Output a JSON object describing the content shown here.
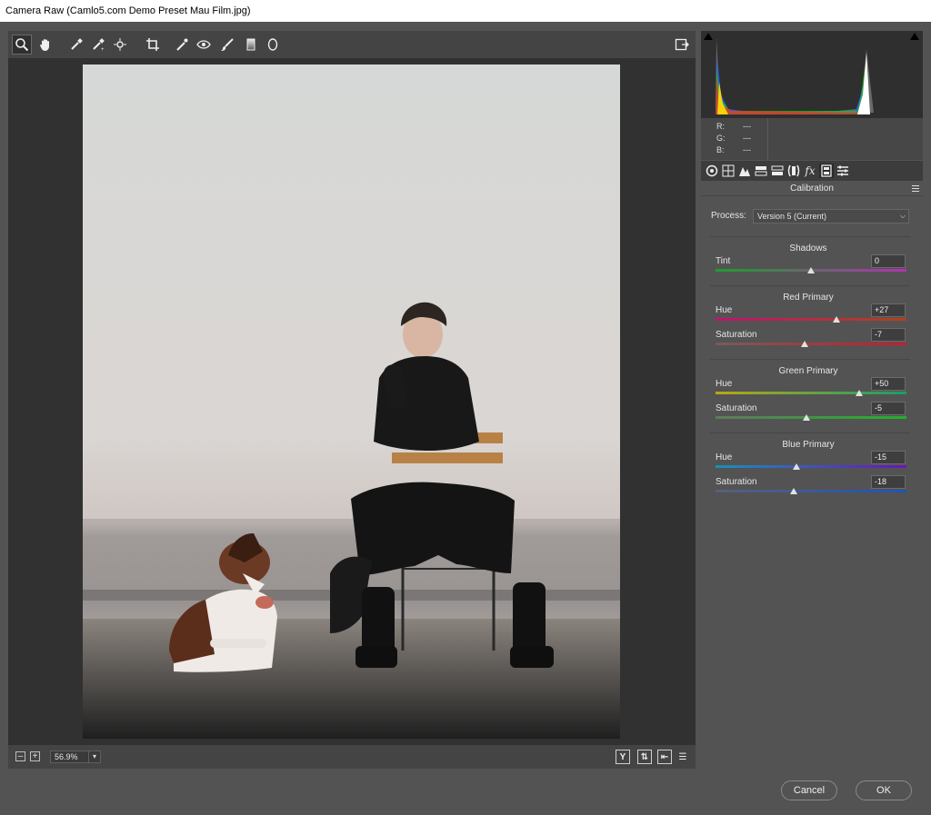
{
  "window": {
    "title": "Camera Raw (Camlo5.com Demo Preset Mau Film.jpg)"
  },
  "toolbar": {
    "tools": [
      "zoom-tool",
      "hand-tool",
      "white-balance-tool",
      "color-sampler-tool",
      "targeted-adjustment-tool",
      "crop-tool",
      "spot-removal-tool",
      "red-eye-tool",
      "adjustment-brush-tool",
      "graduated-filter-tool",
      "radial-filter-tool"
    ],
    "active_tool": "zoom-tool"
  },
  "bottom_bar": {
    "zoom_level": "56.9%"
  },
  "readout": {
    "r_label": "R:",
    "g_label": "G:",
    "b_label": "B:",
    "r": "---",
    "g": "---",
    "b": "---"
  },
  "panel": {
    "title": "Calibration",
    "process_label": "Process:",
    "process_value": "Version 5 (Current)"
  },
  "groups": [
    {
      "title": "Shadows",
      "sliders": [
        {
          "label": "Tint",
          "value": "0",
          "pos": 0.5,
          "gradient": "linear-gradient(to right,#1d9e2a,#b42fb4)"
        }
      ]
    },
    {
      "title": "Red Primary",
      "sliders": [
        {
          "label": "Hue",
          "value": "+27",
          "pos": 0.635,
          "gradient": "linear-gradient(to right,#c0136f,#b0431e)"
        },
        {
          "label": "Saturation",
          "value": "-7",
          "pos": 0.465,
          "gradient": "linear-gradient(to right,#7a5a5a,#c41e2c)"
        }
      ]
    },
    {
      "title": "Green Primary",
      "sliders": [
        {
          "label": "Hue",
          "value": "+50",
          "pos": 0.75,
          "gradient": "linear-gradient(to right,#b8a718,#1a9e6a)"
        },
        {
          "label": "Saturation",
          "value": "-5",
          "pos": 0.475,
          "gradient": "linear-gradient(to right,#5f7a5f,#22b02a)"
        }
      ]
    },
    {
      "title": "Blue Primary",
      "sliders": [
        {
          "label": "Hue",
          "value": "-15",
          "pos": 0.425,
          "gradient": "linear-gradient(to right,#1a8fb8,#6a16b8)"
        },
        {
          "label": "Saturation",
          "value": "-18",
          "pos": 0.41,
          "gradient": "linear-gradient(to right,#5a5f7a,#1f54b8)"
        }
      ]
    }
  ],
  "buttons": {
    "cancel": "Cancel",
    "ok": "OK"
  },
  "colors": {
    "panel_bg": "#535353",
    "canvas_bg": "#313131"
  }
}
